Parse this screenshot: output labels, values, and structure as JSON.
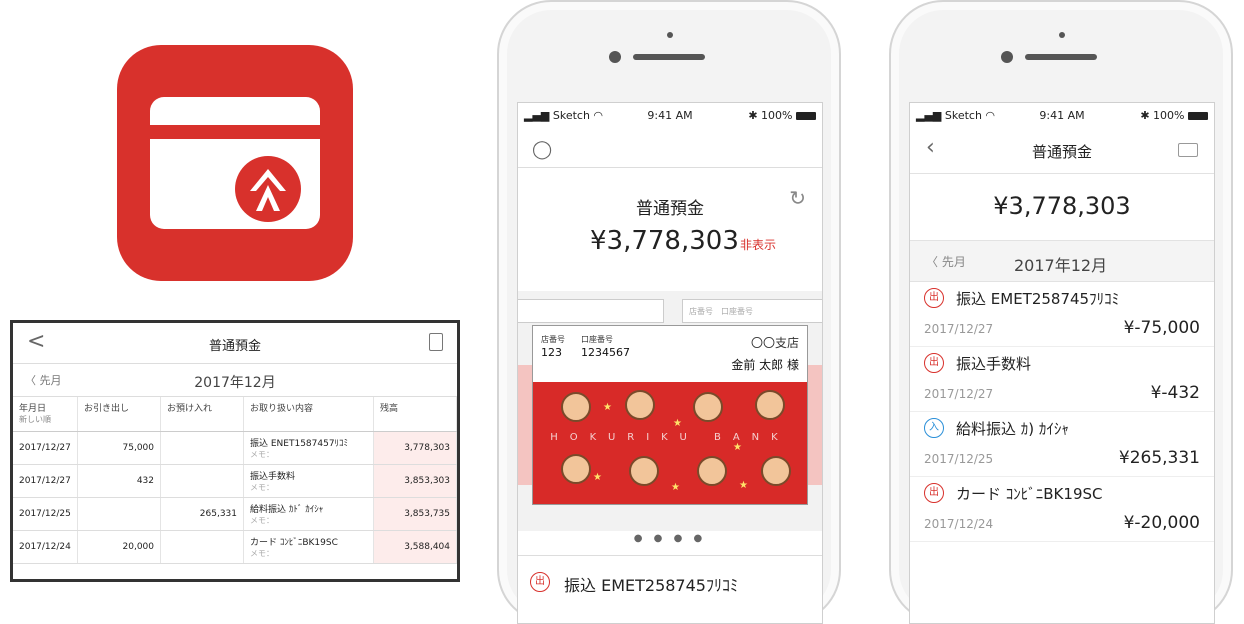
{
  "app_icon": {
    "color": "#d8312c"
  },
  "table_view": {
    "back_label": "<",
    "title": "普通預金",
    "prev_month": "〈 先月",
    "month": "2017年12月",
    "columns": [
      "年月日",
      "お引き出し",
      "お預け入れ",
      "お取り扱い内容",
      "残高"
    ],
    "column_sub": "新しい順",
    "memo_label": "メモ：",
    "rows": [
      {
        "date": "2017/12/27",
        "withdraw": "75,000",
        "deposit": "",
        "desc": "振込 ENET1587457ﾘｺﾐ",
        "balance": "3,778,303"
      },
      {
        "date": "2017/12/27",
        "withdraw": "432",
        "deposit": "",
        "desc": "振込手数料",
        "balance": "3,853,303"
      },
      {
        "date": "2017/12/25",
        "withdraw": "",
        "deposit": "265,331",
        "desc": "給料振込 ｶﾄﾞ ｶｲｼｬ",
        "balance": "3,853,735"
      },
      {
        "date": "2017/12/24",
        "withdraw": "20,000",
        "deposit": "",
        "desc": "カード ｺﾝﾋﾞﾆBK19SC",
        "balance": "3,588,404"
      }
    ]
  },
  "phone1": {
    "status": {
      "carrier": "Sketch",
      "time": "9:41 AM",
      "battery": "100%"
    },
    "title": "普通預金",
    "balance": "¥3,778,303",
    "hide_label": "非表示",
    "side_card_labels": [
      "店番号",
      "口座番号"
    ],
    "card": {
      "store_label": "店番号",
      "store_no": "123",
      "account_label": "口座番号",
      "account_no": "1234567",
      "branch": "〇〇支店",
      "name": "金前 太郎 様",
      "banner": "HOKURIKU BANK"
    },
    "pager": "● ● ● ●",
    "item": {
      "badge": "出",
      "text": "振込 EMET258745ﾌﾘｺﾐ"
    }
  },
  "phone2": {
    "status": {
      "carrier": "Sketch",
      "time": "9:41 AM",
      "battery": "100%"
    },
    "title": "普通預金",
    "balance": "¥3,778,303",
    "prev_month": "〈 先月",
    "month": "2017年12月",
    "transactions": [
      {
        "badge": "出",
        "desc": "振込 EMET258745ﾌﾘｺﾐ",
        "date": "2017/12/27",
        "amount": "¥-75,000"
      },
      {
        "badge": "出",
        "desc": "振込手数料",
        "date": "2017/12/27",
        "amount": "¥-432"
      },
      {
        "badge": "入",
        "desc": "給料振込 ｶ) ｶｲｼｬ",
        "date": "2017/12/25",
        "amount": "¥265,331"
      },
      {
        "badge": "出",
        "desc": "カード ｺﾝﾋﾞﾆBK19SC",
        "date": "2017/12/24",
        "amount": "¥-20,000"
      }
    ]
  }
}
